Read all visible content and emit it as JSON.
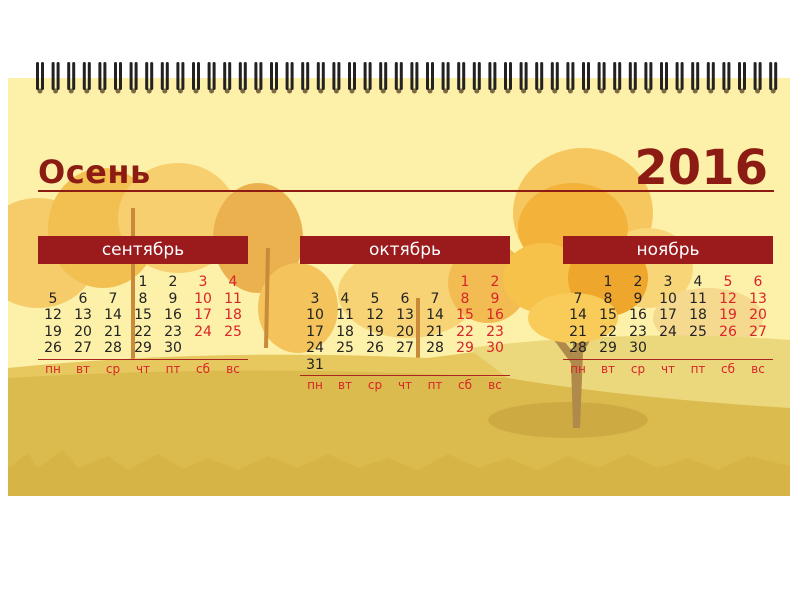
{
  "calendar": {
    "season": "Осень",
    "year": "2016",
    "weekdays": [
      "пн",
      "вт",
      "ср",
      "чт",
      "пт",
      "сб",
      "вс"
    ],
    "months": [
      {
        "name": "сентябрь",
        "weeks": [
          [
            "",
            "",
            "",
            "1",
            "2",
            "3",
            "4"
          ],
          [
            "5",
            "6",
            "7",
            "8",
            "9",
            "10",
            "11"
          ],
          [
            "12",
            "13",
            "14",
            "15",
            "16",
            "17",
            "18"
          ],
          [
            "19",
            "20",
            "21",
            "22",
            "23",
            "24",
            "25"
          ],
          [
            "26",
            "27",
            "28",
            "29",
            "30",
            "",
            ""
          ]
        ]
      },
      {
        "name": "октябрь",
        "weeks": [
          [
            "",
            "",
            "",
            "",
            "",
            "1",
            "2"
          ],
          [
            "3",
            "4",
            "5",
            "6",
            "7",
            "8",
            "9"
          ],
          [
            "10",
            "11",
            "12",
            "13",
            "14",
            "15",
            "16"
          ],
          [
            "17",
            "18",
            "19",
            "20",
            "21",
            "22",
            "23"
          ],
          [
            "24",
            "25",
            "26",
            "27",
            "28",
            "29",
            "30"
          ],
          [
            "31",
            "",
            "",
            "",
            "",
            "",
            ""
          ]
        ]
      },
      {
        "name": "ноябрь",
        "weeks": [
          [
            "",
            "1",
            "2",
            "3",
            "4",
            "5",
            "6"
          ],
          [
            "7",
            "8",
            "9",
            "10",
            "11",
            "12",
            "13"
          ],
          [
            "14",
            "15",
            "16",
            "17",
            "18",
            "19",
            "20"
          ],
          [
            "21",
            "22",
            "23",
            "24",
            "25",
            "26",
            "27"
          ],
          [
            "28",
            "29",
            "30",
            "",
            "",
            "",
            ""
          ]
        ]
      }
    ]
  },
  "colors": {
    "accent": "#9b1b1c",
    "weekend": "#d8242b",
    "paper": "#fdf0a8"
  },
  "icons": [
    "binding-ring-icon",
    "autumn-tree-icon"
  ]
}
